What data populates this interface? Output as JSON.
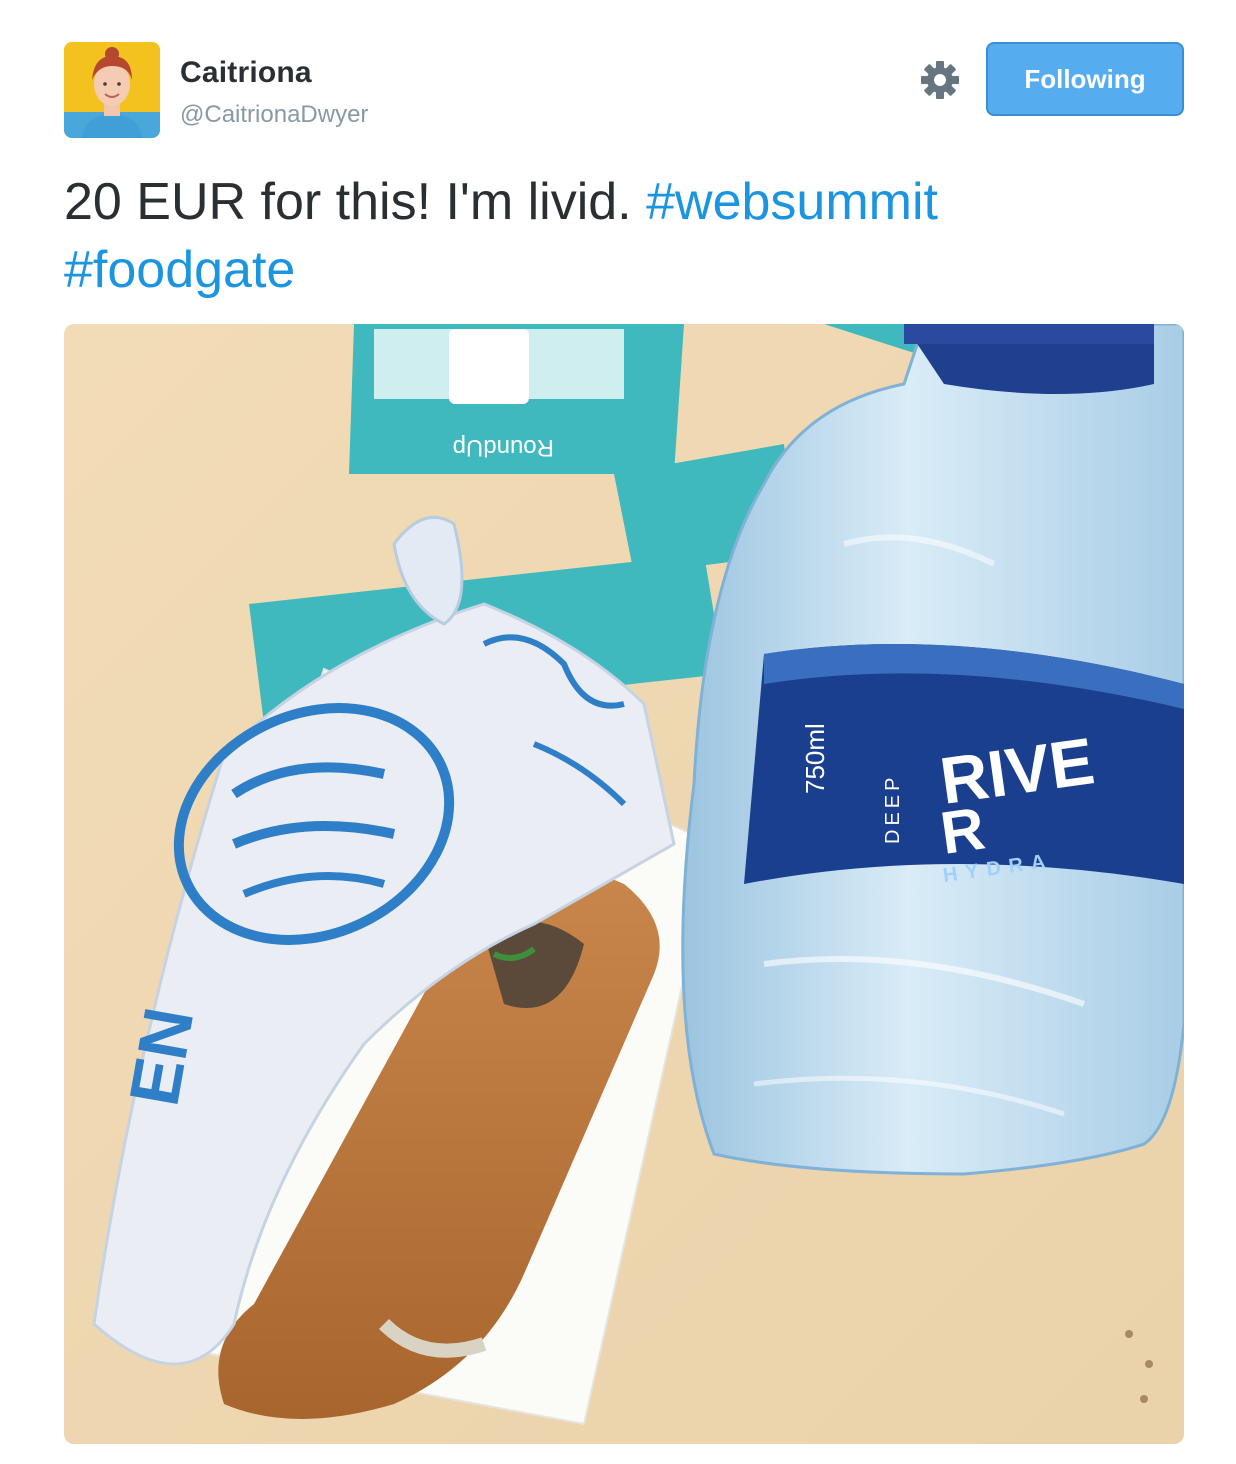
{
  "user": {
    "display_name": "Caitriona",
    "handle": "@CaitrionaDwyer",
    "avatar_icon": "profile-photo"
  },
  "actions": {
    "settings_icon": "gear-icon",
    "follow_label": "Following",
    "follow_color": "#55acee"
  },
  "tweet": {
    "text_plain": "20 EUR for this! I'm livid.",
    "hashtags": [
      "#websummit",
      "#foodgate"
    ],
    "hashtag_color": "#1b95e0"
  },
  "photo": {
    "bottle_label_brand_line1": "RIVE",
    "bottle_label_brand_line2": "R",
    "bottle_label_sub": "HYDRA",
    "bottle_label_deep": "DEEP",
    "bottle_label_volume": "750ml",
    "flyer_text": "RoundUp",
    "wrapper_text": "EN"
  }
}
